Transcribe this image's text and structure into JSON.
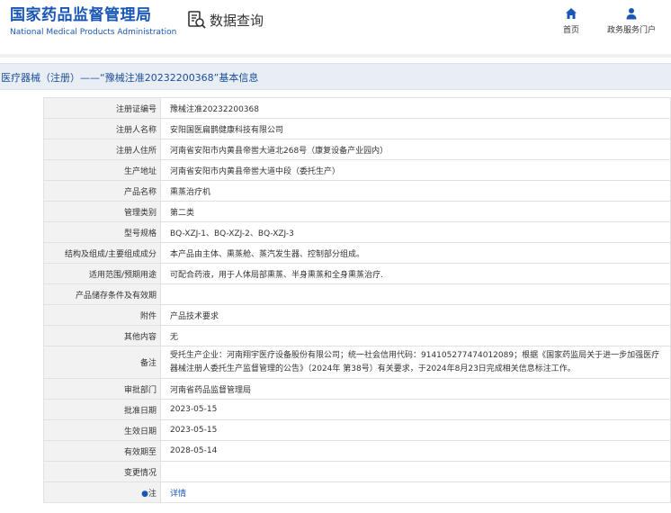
{
  "header": {
    "logo_cn": "国家药品监督管理局",
    "logo_en": "National Medical Products Administration",
    "module_title": "数据查询",
    "nav": [
      {
        "label": "首页",
        "icon": "home-icon"
      },
      {
        "label": "政务服务门户",
        "icon": "user-icon"
      }
    ]
  },
  "page_title": "医疗器械（注册）——“豫械注准20232200368”基本信息",
  "colors": {
    "brand": "#1a57b5",
    "title_bg": "#e9eef5",
    "label_bg": "#f2f2f2"
  },
  "rows": [
    {
      "label": "注册证编号",
      "value": "豫械注准20232200368"
    },
    {
      "label": "注册人名称",
      "value": "安阳国医扁鹊健康科技有限公司"
    },
    {
      "label": "注册人住所",
      "value": "河南省安阳市内黄县帝喾大道北268号（康复设备产业园内）"
    },
    {
      "label": "生产地址",
      "value": "河南省安阳市内黄县帝喾大道中段（委托生产）"
    },
    {
      "label": "产品名称",
      "value": "熏蒸治疗机"
    },
    {
      "label": "管理类别",
      "value": "第二类"
    },
    {
      "label": "型号规格",
      "value": "BQ-XZJ-1、BQ-XZJ-2、BQ-XZJ-3"
    },
    {
      "label": "结构及组成/主要组成成分",
      "value": "本产品由主体、熏蒸舱、蒸汽发生器、控制部分组成。"
    },
    {
      "label": "适用范围/预期用途",
      "value": "可配合药液，用于人体局部熏蒸、半身熏蒸和全身熏蒸治疗."
    },
    {
      "label": "产品储存条件及有效期",
      "value": ""
    },
    {
      "label": "附件",
      "value": "产品技术要求"
    },
    {
      "label": "其他内容",
      "value": "无"
    },
    {
      "label": "备注",
      "value": "受托生产企业：河南翔宇医疗设备股份有限公司；统一社会信用代码：91410527747401208​9；根据《国家药监局关于进一步加强医疗器械注册人委托生产监督管理的公告》（2024年 第38号）有关要求，于2024年8月23日完成相关信息标注工作。"
    },
    {
      "label": "审批部门",
      "value": "河南省药品监督管理局"
    },
    {
      "label": "批准日期",
      "value": "2023-05-15"
    },
    {
      "label": "生效日期",
      "value": "2023-05-15"
    },
    {
      "label": "有效期至",
      "value": "2028-05-14"
    },
    {
      "label": "变更情况",
      "value": ""
    }
  ],
  "note_row": {
    "label": "注",
    "value": "详情"
  }
}
